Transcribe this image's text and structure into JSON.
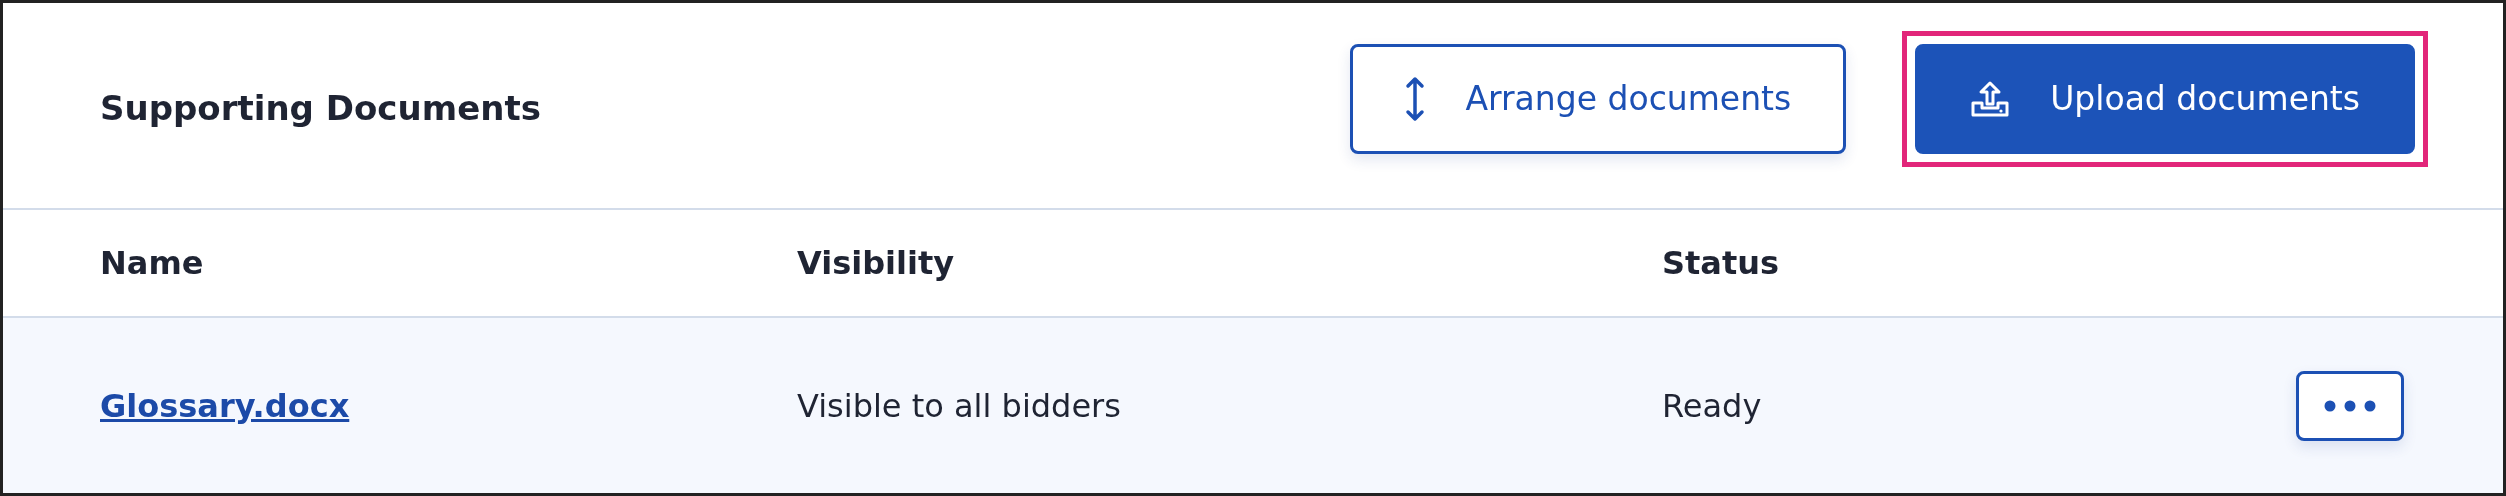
{
  "panel": {
    "title": "Supporting Documents"
  },
  "actions": [
    {
      "kind": "secondary",
      "label": "Arrange documents",
      "highlighted": false
    },
    {
      "kind": "primary",
      "label": "Upload documents",
      "highlighted": true
    }
  ],
  "table": {
    "columns": [
      "Name",
      "Visibility",
      "Status"
    ],
    "rows": [
      {
        "name": "Glossary.docx",
        "visibility": "Visible to all bidders",
        "status": "Ready"
      }
    ]
  }
}
